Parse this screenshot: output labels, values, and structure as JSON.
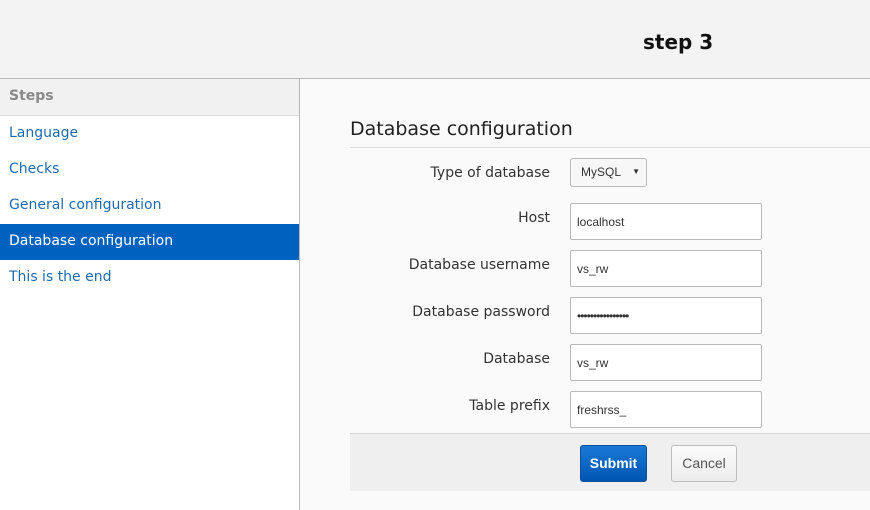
{
  "header": {
    "title": "step 3"
  },
  "sidebar": {
    "heading": "Steps",
    "items": [
      {
        "label": "Language"
      },
      {
        "label": "Checks"
      },
      {
        "label": "General configuration"
      },
      {
        "label": "Database configuration"
      },
      {
        "label": "This is the end"
      }
    ],
    "active_index": 3
  },
  "main": {
    "section_title": "Database configuration",
    "fields": {
      "db_type": {
        "label": "Type of database",
        "value": "MySQL"
      },
      "host": {
        "label": "Host",
        "value": "localhost"
      },
      "username": {
        "label": "Database username",
        "value": "vs_rw"
      },
      "password": {
        "label": "Database password",
        "value": "••••••••••••••••"
      },
      "database": {
        "label": "Database",
        "value": "vs_rw"
      },
      "prefix": {
        "label": "Table prefix",
        "value": "freshrss_"
      }
    },
    "actions": {
      "submit_label": "Submit",
      "cancel_label": "Cancel"
    }
  },
  "colors": {
    "accent": "#0062be",
    "link": "#1e6ab1"
  }
}
